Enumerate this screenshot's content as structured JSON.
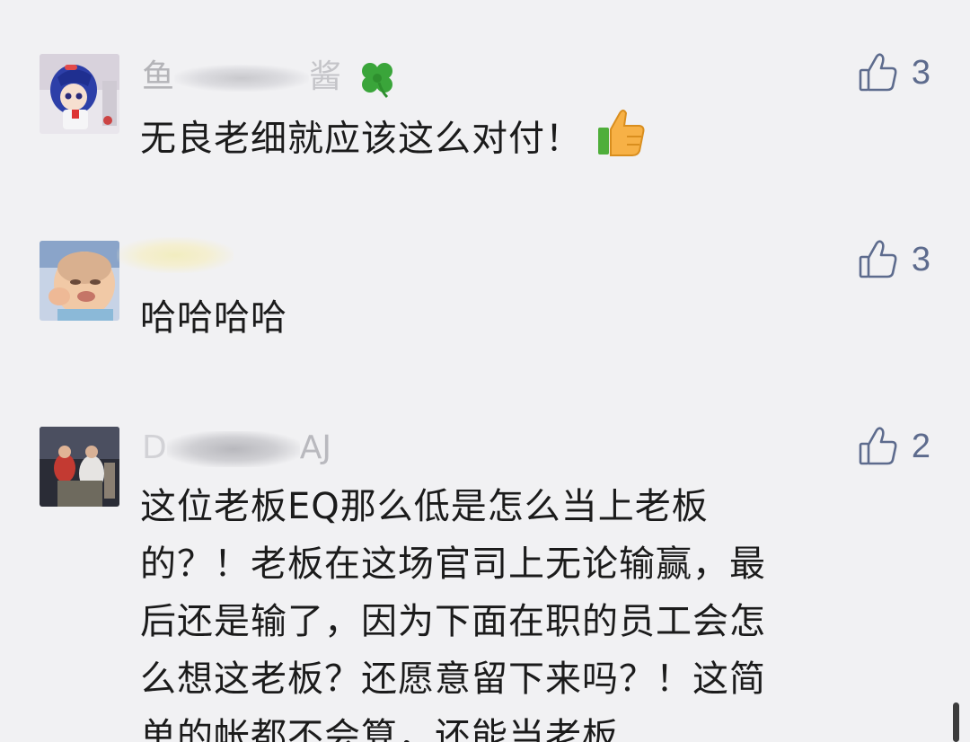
{
  "comments": [
    {
      "nickname_start": "鱼",
      "nickname_end": "酱",
      "nickname_emoji": "four-leaf-clover",
      "text": "无良老细就应该这么对付！",
      "text_emoji": "thumbs-up",
      "likes": "3"
    },
    {
      "nickname_start": "",
      "nickname_end": "",
      "text": "哈哈哈哈",
      "likes": "3"
    },
    {
      "nickname_start": "D",
      "nickname_end": "AJ",
      "text_lines": [
        "这位老板EQ那么低是怎么当上老板",
        "的？！老板在这场官司上无论输赢，最",
        "后还是输了，因为下面在职的员工会怎",
        "么想这老板？还愿意留下来吗？！这简",
        "单的帐都不会算，还能当老板"
      ],
      "likes": "2"
    }
  ],
  "colors": {
    "background": "#f1f1f3",
    "text": "#1b1b1b",
    "nickname": "#a8a8ad",
    "like": "#5d6b8d"
  }
}
